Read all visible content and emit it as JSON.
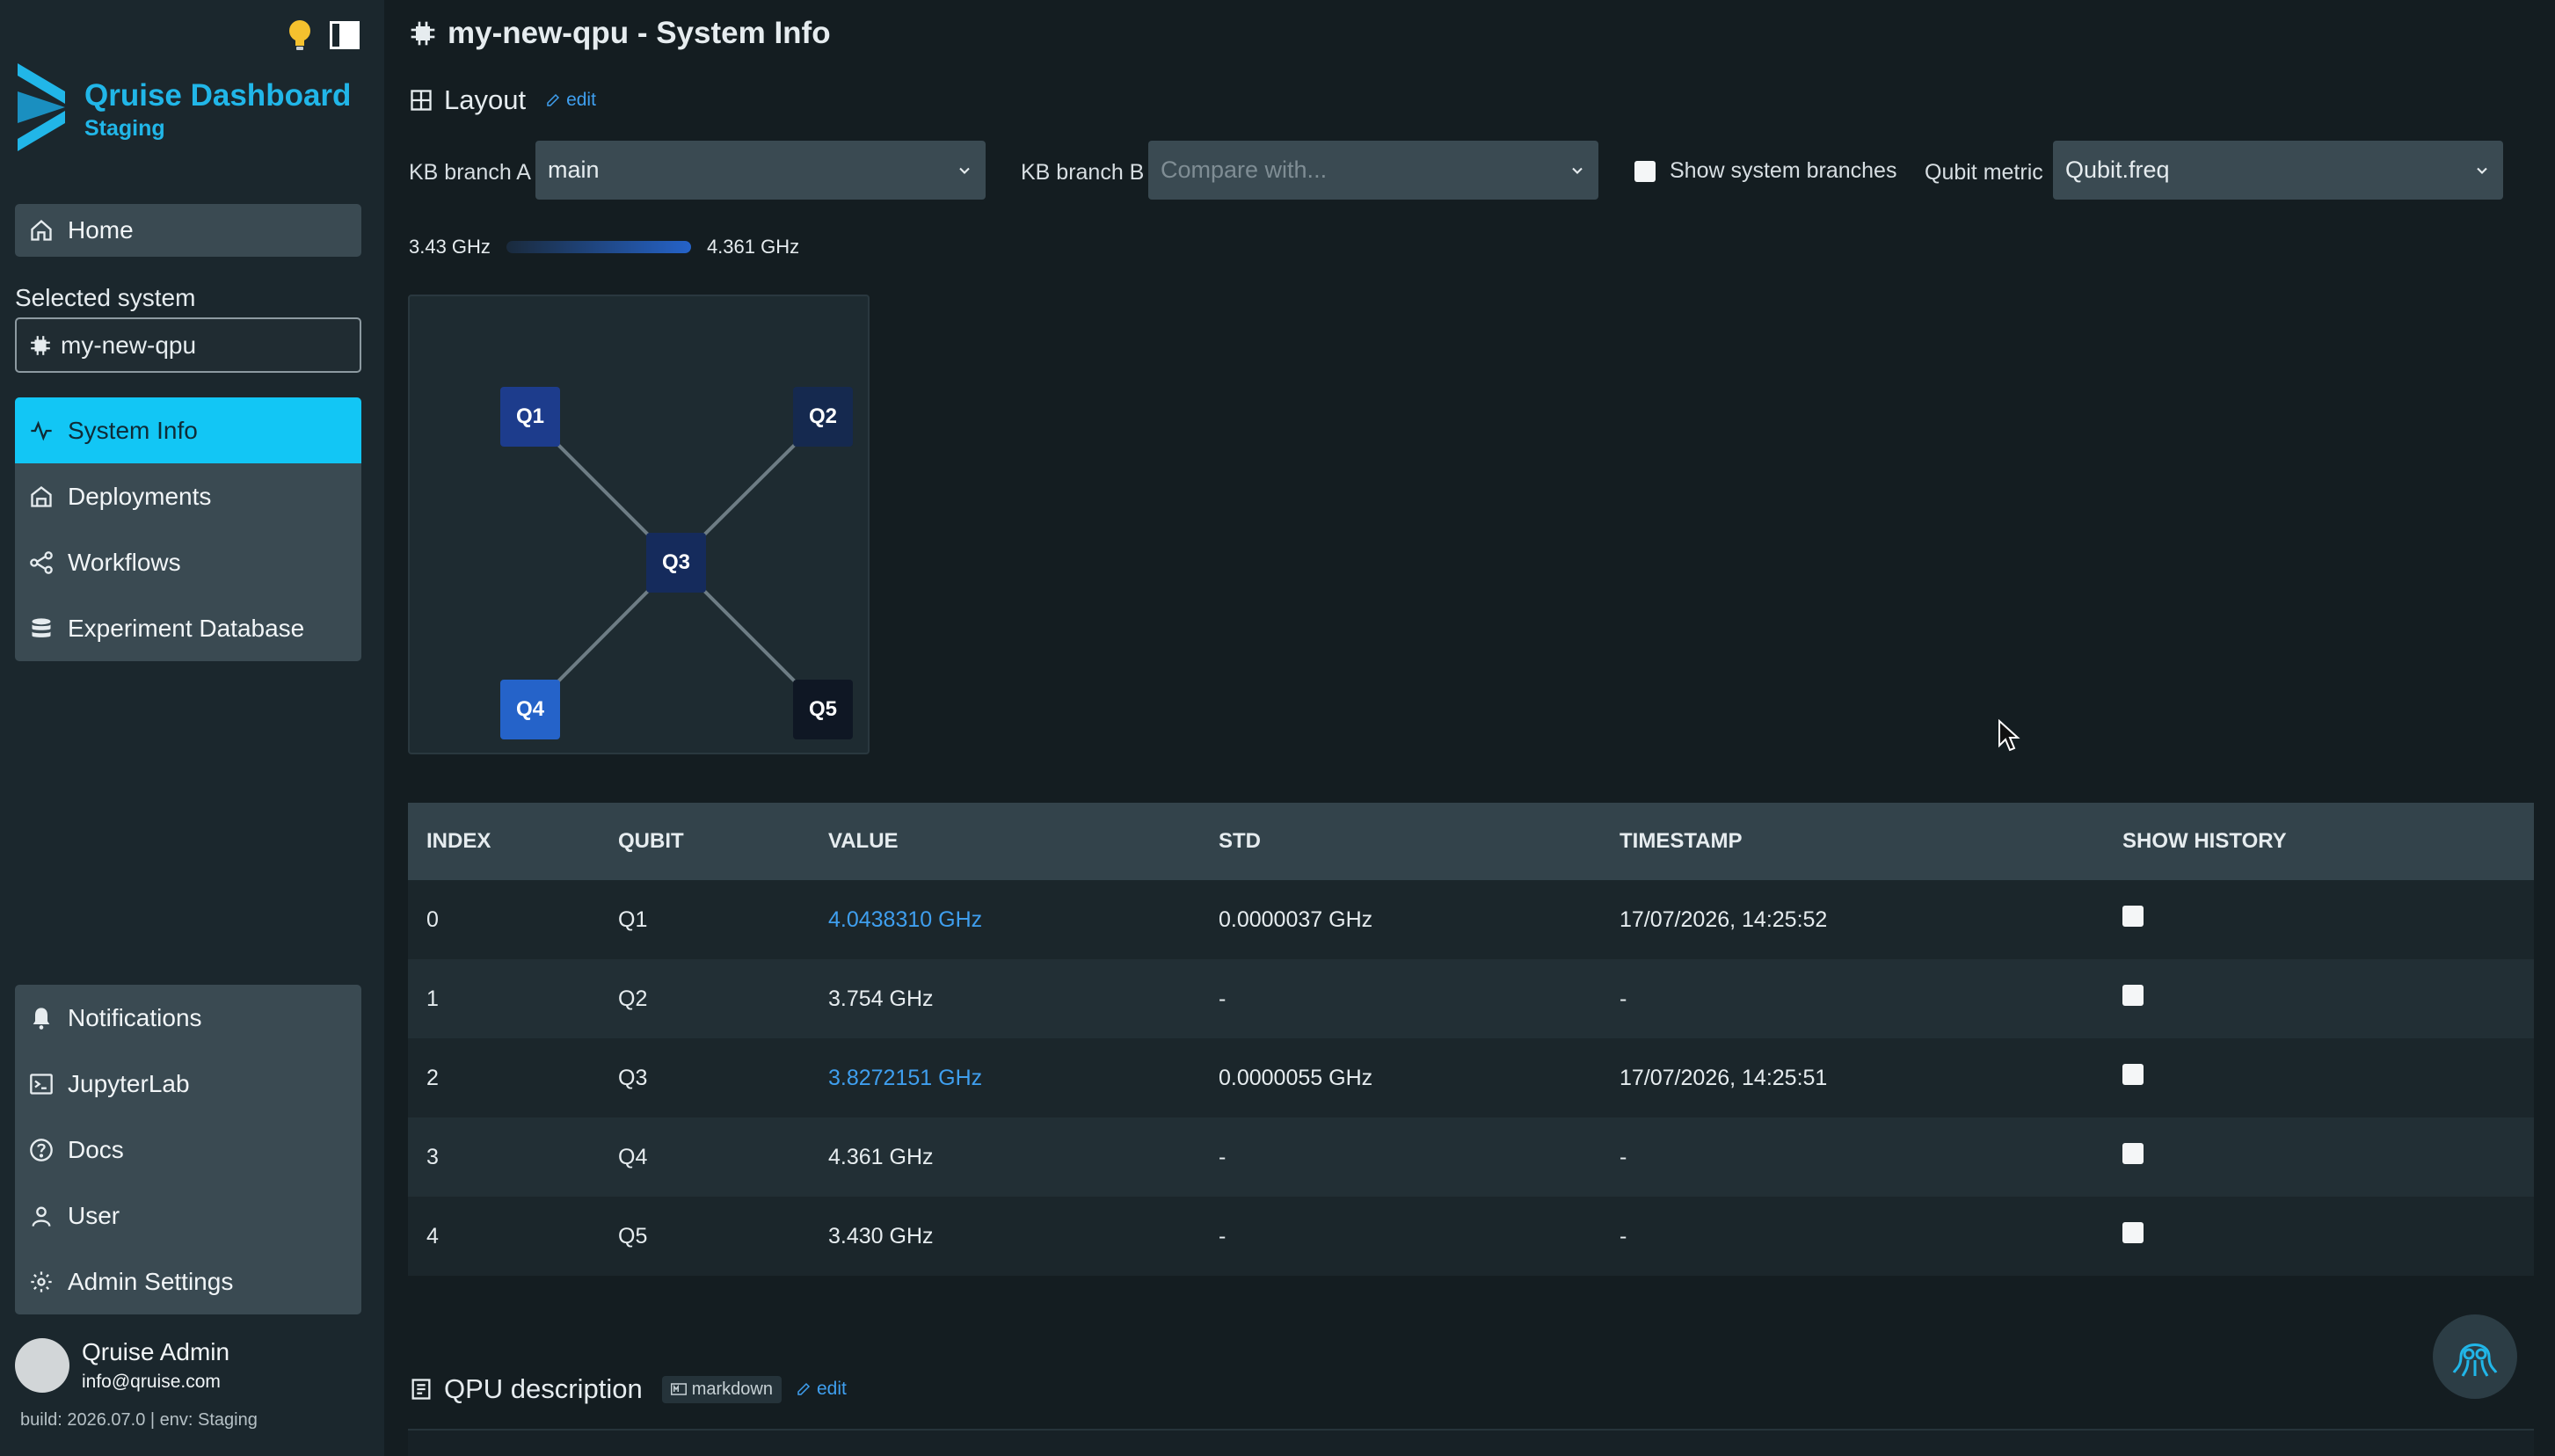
{
  "sidebar": {
    "brand_title": "Qruise Dashboard",
    "brand_subtitle": "Staging",
    "home": "Home",
    "selected_system_label": "Selected system",
    "selected_system": "my-new-qpu",
    "nav": [
      {
        "label": "System Info",
        "icon": "activity-icon",
        "active": true
      },
      {
        "label": "Deployments",
        "icon": "deploy-icon",
        "active": false
      },
      {
        "label": "Workflows",
        "icon": "workflow-icon",
        "active": false
      },
      {
        "label": "Experiment Database",
        "icon": "database-icon",
        "active": false
      }
    ],
    "bottom_nav": [
      {
        "label": "Notifications",
        "icon": "bell-icon"
      },
      {
        "label": "JupyterLab",
        "icon": "terminal-icon"
      },
      {
        "label": "Docs",
        "icon": "help-icon"
      },
      {
        "label": "User",
        "icon": "user-icon"
      },
      {
        "label": "Admin Settings",
        "icon": "gear-icon"
      }
    ],
    "user_name": "Qruise Admin",
    "user_email": "info@qruise.com",
    "build": "build: 2026.07.0 | env: Staging"
  },
  "page": {
    "title": "my-new-qpu - System Info",
    "layout_heading": "Layout",
    "edit": "edit"
  },
  "controls": {
    "kb_branch_a_label": "KB branch A",
    "kb_branch_a_value": "main",
    "kb_branch_b_label": "KB branch B",
    "kb_branch_b_placeholder": "Compare with...",
    "show_system_branches": "Show system branches",
    "qubit_metric_label": "Qubit metric",
    "qubit_metric_value": "Qubit.freq"
  },
  "legend": {
    "min": "3.43 GHz",
    "max": "4.361 GHz"
  },
  "graph": {
    "nodes": [
      {
        "id": "Q1",
        "color": "#1d3c8c"
      },
      {
        "id": "Q2",
        "color": "#15294f"
      },
      {
        "id": "Q3",
        "color": "#152b5c"
      },
      {
        "id": "Q4",
        "color": "#2563c9"
      },
      {
        "id": "Q5",
        "color": "#0f1724"
      }
    ],
    "edges": [
      [
        "Q1",
        "Q3"
      ],
      [
        "Q2",
        "Q3"
      ],
      [
        "Q4",
        "Q3"
      ],
      [
        "Q5",
        "Q3"
      ]
    ]
  },
  "table": {
    "headers": [
      "INDEX",
      "QUBIT",
      "VALUE",
      "STD",
      "TIMESTAMP",
      "SHOW HISTORY"
    ],
    "rows": [
      {
        "index": "0",
        "qubit": "Q1",
        "value": "4.0438310 GHz",
        "link": true,
        "std": "0.0000037 GHz",
        "timestamp": "17/07/2026, 14:25:52"
      },
      {
        "index": "1",
        "qubit": "Q2",
        "value": "3.754 GHz",
        "link": false,
        "std": "-",
        "timestamp": "-"
      },
      {
        "index": "2",
        "qubit": "Q3",
        "value": "3.8272151 GHz",
        "link": true,
        "std": "0.0000055 GHz",
        "timestamp": "17/07/2026, 14:25:51"
      },
      {
        "index": "3",
        "qubit": "Q4",
        "value": "4.361 GHz",
        "link": false,
        "std": "-",
        "timestamp": "-"
      },
      {
        "index": "4",
        "qubit": "Q5",
        "value": "3.430 GHz",
        "link": false,
        "std": "-",
        "timestamp": "-"
      }
    ]
  },
  "qpu": {
    "heading": "QPU description",
    "badge": "markdown",
    "edit": "edit"
  }
}
